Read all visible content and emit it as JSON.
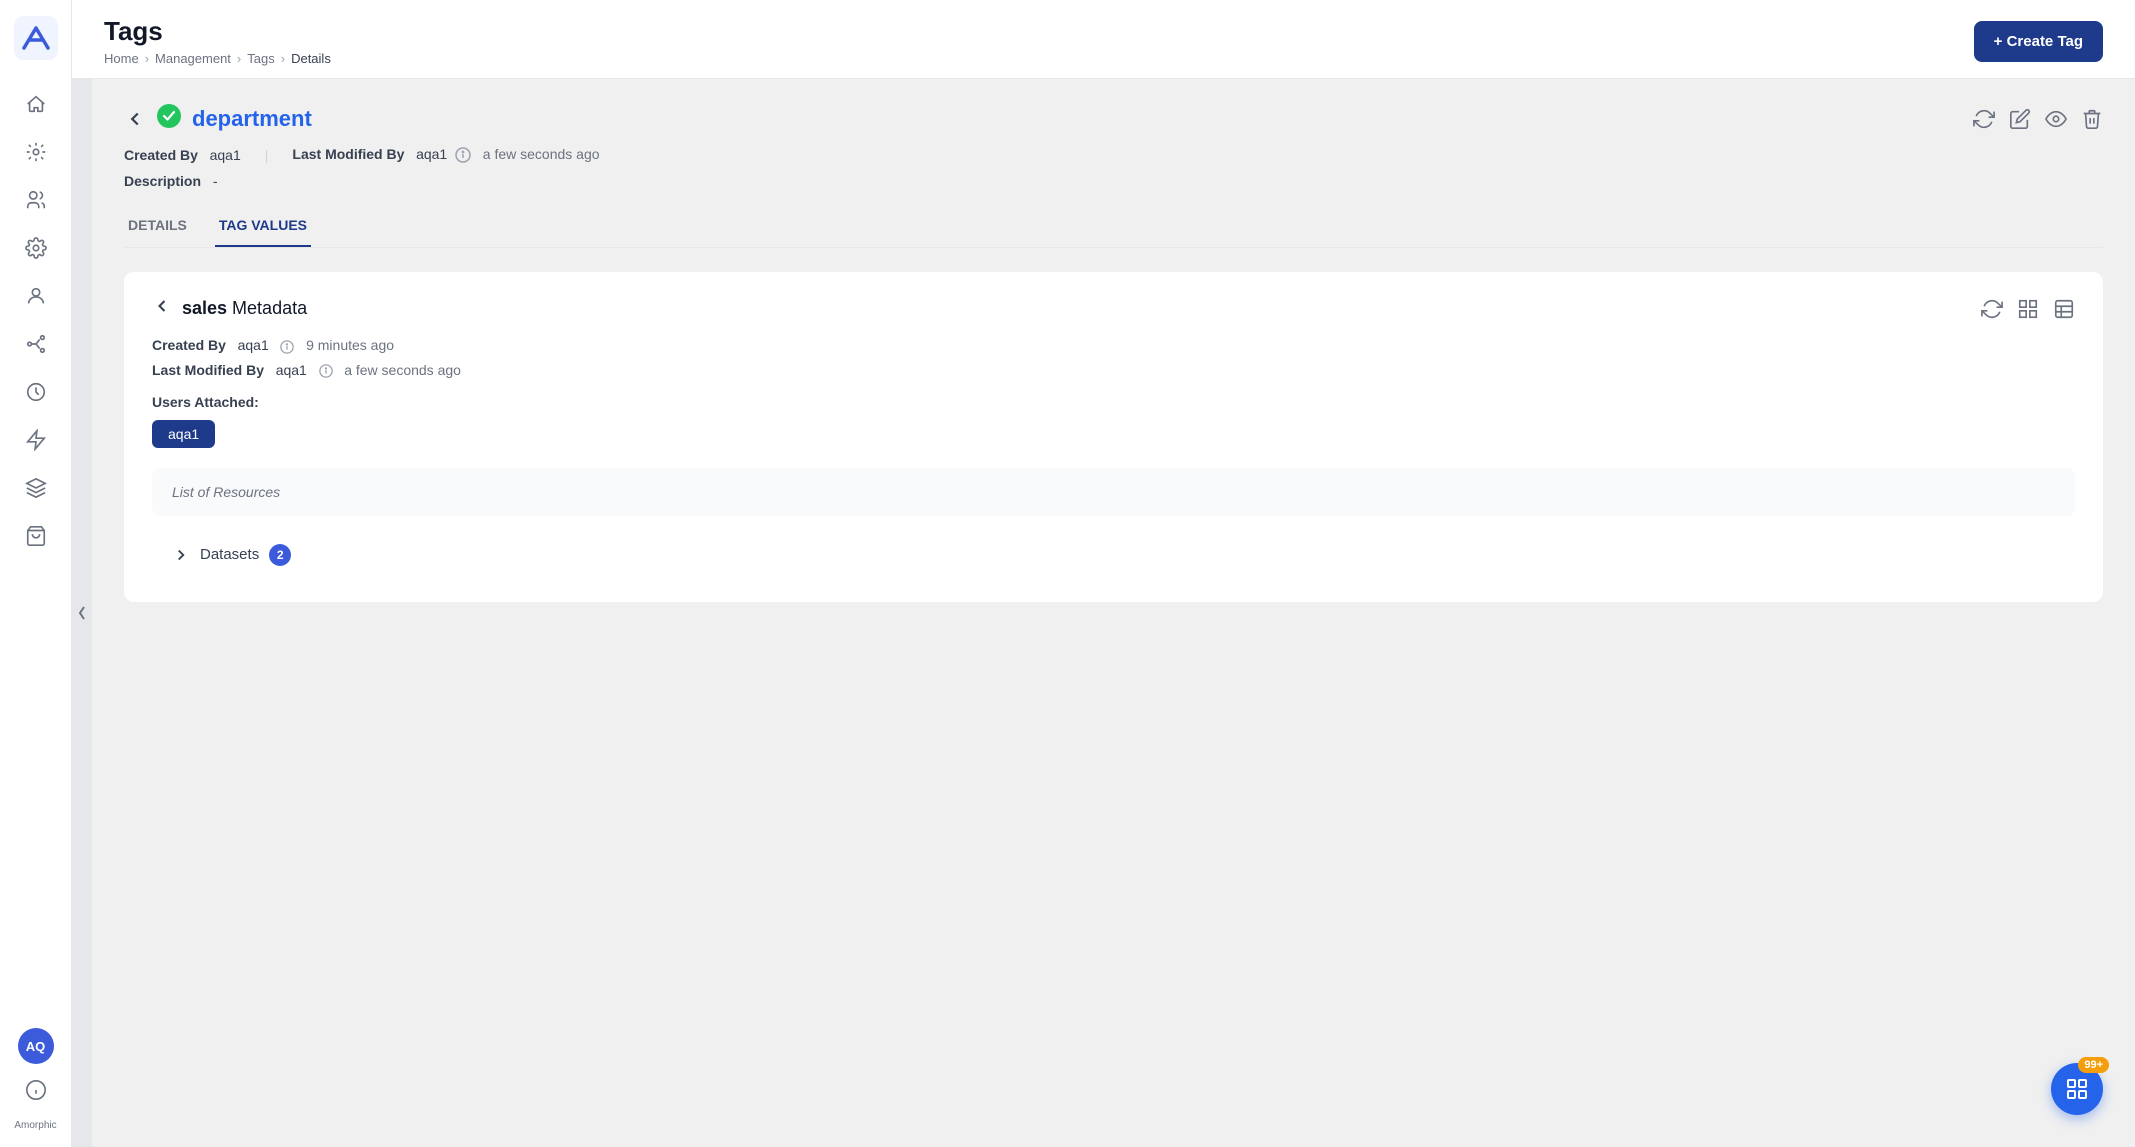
{
  "app": {
    "name": "Amorphic",
    "logo_initials": "A"
  },
  "header": {
    "page_title": "Tags",
    "breadcrumb": [
      "Home",
      "Management",
      "Tags",
      "Details"
    ],
    "create_button_label": "+ Create Tag"
  },
  "sidebar": {
    "avatar_initials": "AQ",
    "brand_label": "Amorphic",
    "nav_items": [
      {
        "name": "home-icon",
        "label": "Home"
      },
      {
        "name": "analytics-icon",
        "label": "Analytics"
      },
      {
        "name": "users-icon",
        "label": "Users"
      },
      {
        "name": "settings-icon",
        "label": "Settings"
      },
      {
        "name": "profile-icon",
        "label": "Profile"
      },
      {
        "name": "connections-icon",
        "label": "Connections"
      },
      {
        "name": "clock-icon",
        "label": "Clock"
      },
      {
        "name": "lightning-icon",
        "label": "Lightning"
      },
      {
        "name": "layers-icon",
        "label": "Layers"
      },
      {
        "name": "bag-icon",
        "label": "Bag"
      }
    ]
  },
  "tag_detail": {
    "tag_name": "department",
    "created_by_label": "Created By",
    "created_by_value": "aqa1",
    "last_modified_label": "Last Modified By",
    "last_modified_value": "aqa1",
    "last_modified_time": "a few seconds ago",
    "description_label": "Description",
    "description_value": "-"
  },
  "tabs": [
    {
      "id": "details",
      "label": "DETAILS"
    },
    {
      "id": "tag-values",
      "label": "TAG VALUES",
      "active": true
    }
  ],
  "inner_card": {
    "title_bold": "sales",
    "title_rest": " Metadata",
    "created_by_label": "Created By",
    "created_by_value": "aqa1",
    "created_by_time": "9 minutes ago",
    "last_modified_label": "Last Modified By",
    "last_modified_value": "aqa1",
    "last_modified_time": "a few seconds ago",
    "users_attached_label": "Users Attached:",
    "users": [
      "aqa1"
    ],
    "resources_label": "List of Resources",
    "datasets_label": "Datasets",
    "datasets_count": "2"
  },
  "fab": {
    "badge": "99+",
    "icon": "command"
  }
}
